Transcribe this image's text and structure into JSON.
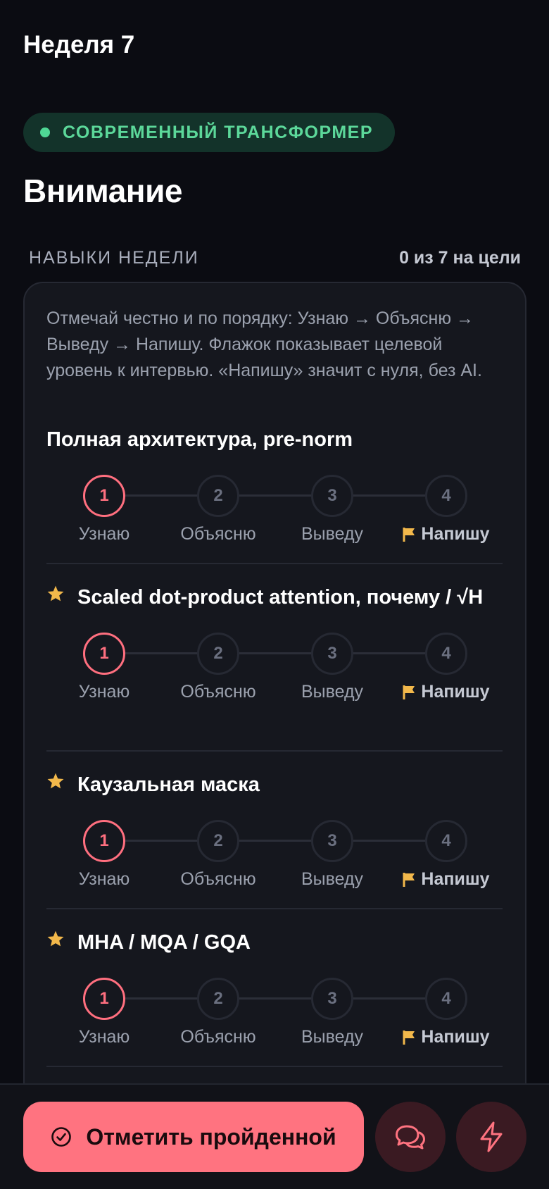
{
  "header": {
    "week": "Неделя 7"
  },
  "module_tag": {
    "label": "СОВРЕМЕННЫЙ ТРАНСФОРМЕР",
    "color": "#4fd895"
  },
  "page_title": "Внимание",
  "skills": {
    "section_label": "НАВЫКИ НЕДЕЛИ",
    "progress_text": "0 из 7 на цели",
    "intro": "Отмечай честно и по порядку: Узнаю → Объясню → Выведу → Напишу. Флажок показывает целевой уровень к интервью. «Напишу» значит с нуля, без AI.",
    "levels": {
      "n1": "1",
      "n2": "2",
      "n3": "3",
      "n4": "4",
      "l1": "Узнаю",
      "l2": "Объясню",
      "l3": "Выведу",
      "l4": "Напишу"
    },
    "items": [
      {
        "title": "Полная архитектура, pre-norm",
        "starred": false,
        "current_level": 1,
        "target_level": 4
      },
      {
        "title": "Scaled dot-product attention, почему / √H",
        "starred": true,
        "current_level": 1,
        "target_level": 4
      },
      {
        "title": "Каузальная маска",
        "starred": true,
        "current_level": 1,
        "target_level": 4
      },
      {
        "title": "MHA / MQA / GQA",
        "starred": true,
        "current_level": 1,
        "target_level": 4
      }
    ]
  },
  "actions": {
    "mark_done": "Отметить пройденной",
    "chat_icon": "chat-bubbles-icon",
    "quick_icon": "lightning-icon"
  },
  "colors": {
    "accent": "#ff7380",
    "active_step": "#ff6f7f",
    "star": "#f2b84b",
    "background": "#0b0c12",
    "card": "#15171e"
  }
}
